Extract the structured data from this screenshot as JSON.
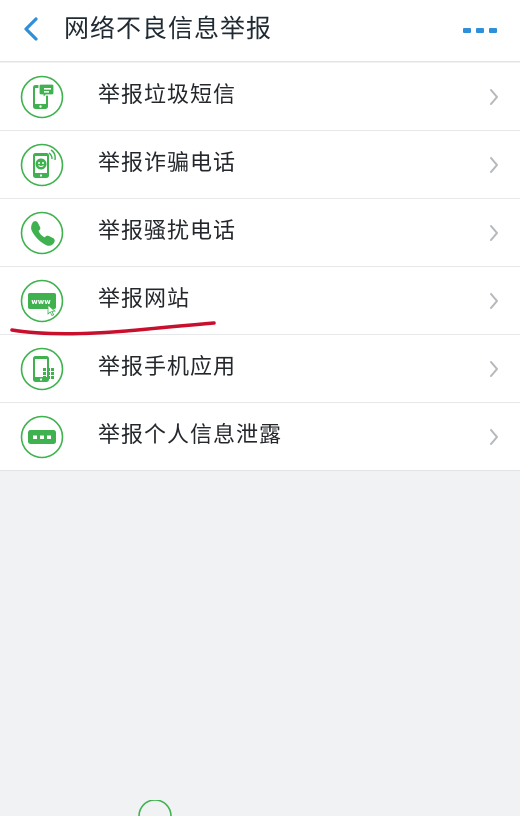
{
  "header": {
    "title": "网络不良信息举报",
    "back_icon": "chevron-left-icon",
    "more_icon": "more-dots-icon",
    "accent_color": "#2f8fd8"
  },
  "list": {
    "icon_color": "#3fb24f",
    "items": [
      {
        "label": "举报垃圾短信",
        "icon": "sms-phone-icon"
      },
      {
        "label": "举报诈骗电话",
        "icon": "fraud-face-icon"
      },
      {
        "label": "举报骚扰电话",
        "icon": "phone-handset-icon"
      },
      {
        "label": "举报网站",
        "icon": "www-browser-icon"
      },
      {
        "label": "举报手机应用",
        "icon": "phone-app-icon"
      },
      {
        "label": "举报个人信息泄露",
        "icon": "message-dots-icon"
      }
    ]
  },
  "annotation_color": "#c8102e"
}
